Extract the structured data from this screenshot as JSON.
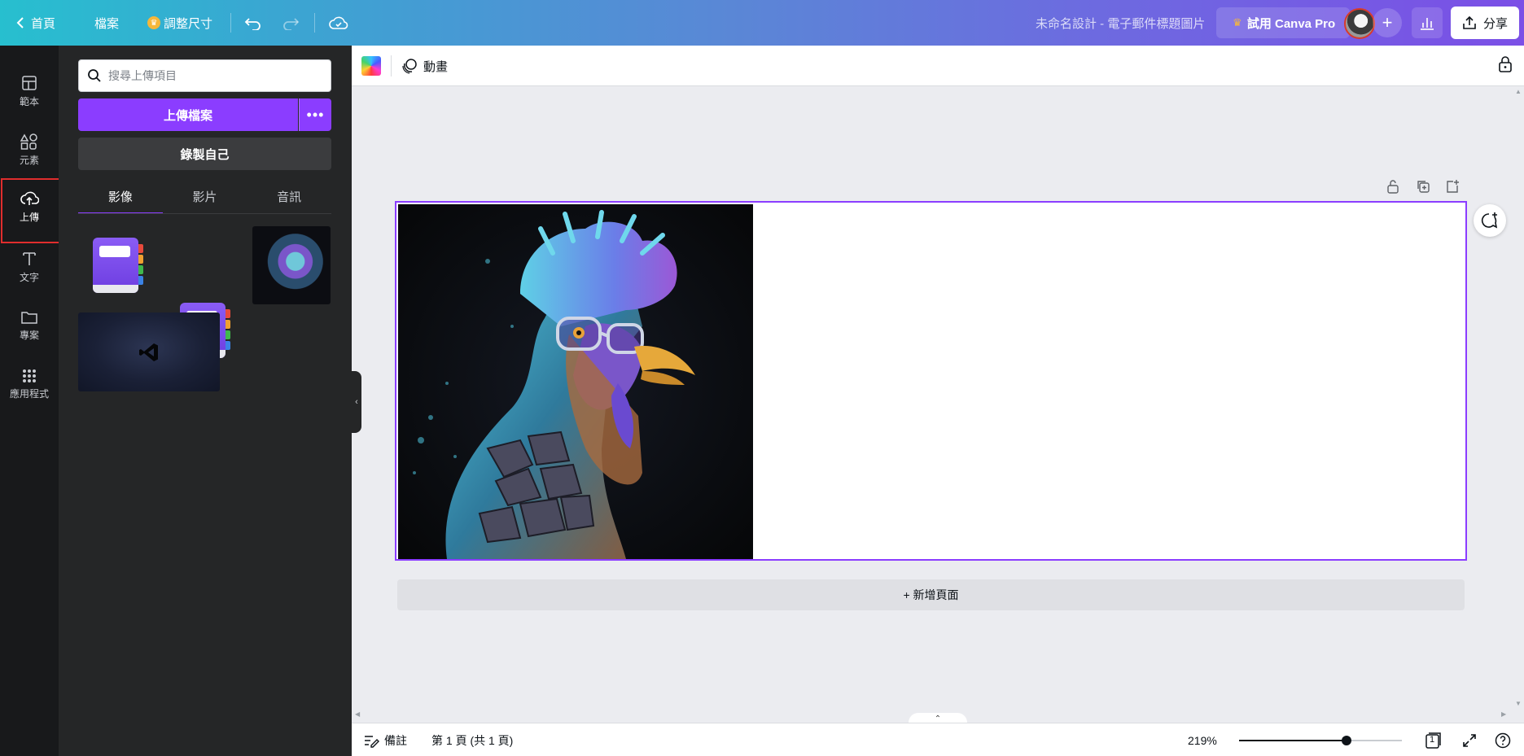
{
  "topbar": {
    "home_label": "首頁",
    "file_label": "檔案",
    "resize_label": "調整尺寸",
    "design_title": "未命名設計 - 電子郵件標題圖片",
    "try_pro_label": "試用 Canva Pro",
    "share_label": "分享"
  },
  "rail": {
    "items": [
      {
        "label": "範本",
        "icon": "template-icon"
      },
      {
        "label": "元素",
        "icon": "elements-icon"
      },
      {
        "label": "上傳",
        "icon": "upload-cloud-icon"
      },
      {
        "label": "文字",
        "icon": "text-icon"
      },
      {
        "label": "專案",
        "icon": "folder-icon"
      },
      {
        "label": "應用程式",
        "icon": "apps-grid-icon"
      }
    ],
    "active_index": 2
  },
  "panel": {
    "search_placeholder": "搜尋上傳項目",
    "upload_button": "上傳檔案",
    "more_button": "•••",
    "record_button": "錄製自己",
    "tabs": [
      "影像",
      "影片",
      "音訊"
    ],
    "active_tab": 0,
    "uploads": [
      {
        "type": "image",
        "name": "purple-book-icon"
      },
      {
        "type": "image",
        "name": "purple-book-icon"
      },
      {
        "type": "image",
        "name": "rooster-art"
      },
      {
        "type": "image",
        "name": "vscode-wallpaper"
      }
    ]
  },
  "toolbar": {
    "animate_label": "動畫"
  },
  "canvas": {
    "add_page_label": "+ 新增頁面",
    "image": "neon-rooster-with-glasses"
  },
  "bottombar": {
    "notes_label": "備註",
    "page_indicator": "第 1 頁 (共 1 頁)",
    "zoom_label": "219%",
    "zoom_fraction": 0.66,
    "page_count": "1"
  },
  "colors": {
    "accent": "#8b3dff",
    "rail_bg": "#18191b",
    "panel_bg": "#252627",
    "highlight": "#e02d2d"
  }
}
